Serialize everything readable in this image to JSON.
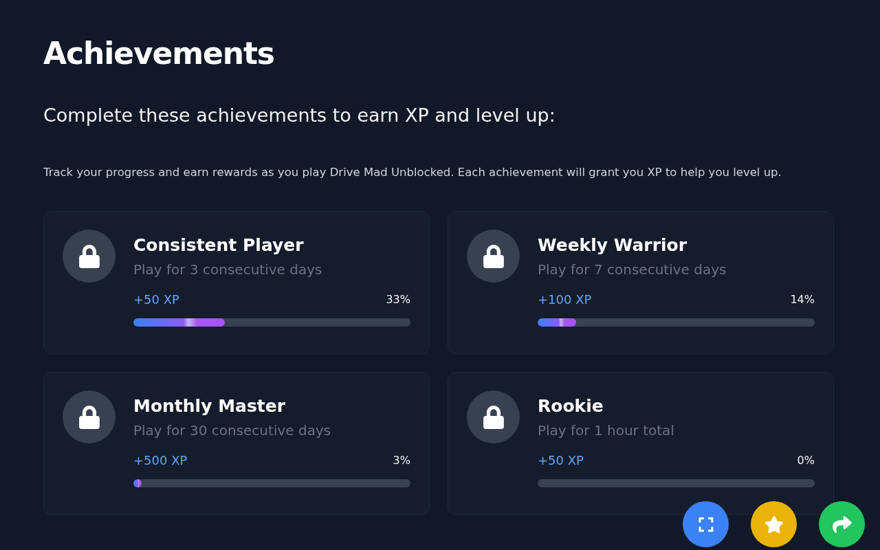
{
  "title": "Achievements",
  "subtitle": "Complete these achievements to earn XP and level up:",
  "description": "Track your progress and earn rewards as you play Drive Mad Unblocked. Each achievement will grant you XP to help you level up.",
  "achievements": [
    {
      "name": "Consistent Player",
      "requirement": "Play for 3 consecutive days",
      "reward": "+50 XP",
      "percent": "33%",
      "level": 0.33,
      "locked": true
    },
    {
      "name": "Weekly Warrior",
      "requirement": "Play for 7 consecutive days",
      "reward": "+100 XP",
      "percent": "14%",
      "level": 0.14,
      "locked": true
    },
    {
      "name": "Monthly Master",
      "requirement": "Play for 30 consecutive days",
      "reward": "+500 XP",
      "percent": "3%",
      "level": 0.03,
      "locked": true
    },
    {
      "name": "Rookie",
      "requirement": "Play for 1 hour total",
      "reward": "+50 XP",
      "percent": "0%",
      "level": 0,
      "locked": true
    }
  ],
  "floating_buttons": [
    {
      "kind": "fullscreen",
      "color": "#3b82f6"
    },
    {
      "kind": "favorite",
      "color": "#eab308"
    },
    {
      "kind": "share",
      "color": "#22c55e"
    }
  ]
}
